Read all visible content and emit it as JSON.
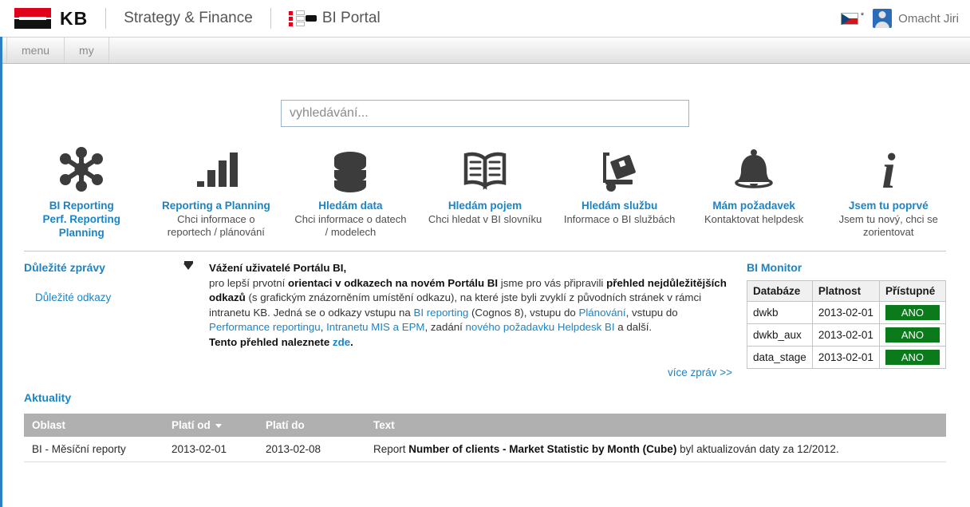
{
  "header": {
    "logo_text": "KB",
    "logo_name": "kb-logo",
    "section_title": "Strategy & Finance",
    "portal_title": "BI Portal",
    "flag_name": "czech-flag-icon",
    "user_name": "Omacht Jiri"
  },
  "menubar": {
    "tabs": [
      {
        "label": "menu"
      },
      {
        "label": "my"
      }
    ]
  },
  "search": {
    "placeholder": "vyhledávání...",
    "value": ""
  },
  "icon_nav": [
    {
      "icon": "network-nodes-icon",
      "title": "BI Reporting\nPerf. Reporting\nPlanning",
      "title_lines": [
        "BI Reporting",
        "Perf. Reporting",
        "Planning"
      ],
      "subtitle": ""
    },
    {
      "icon": "bar-chart-icon",
      "title": "Reporting a Planning",
      "title_lines": [
        "Reporting a Planning"
      ],
      "subtitle": "Chci informace o reportech / plánování",
      "sub_lines": [
        "Chci informace o",
        "reportech / plánování"
      ]
    },
    {
      "icon": "database-icon",
      "title": "Hledám data",
      "title_lines": [
        "Hledám data"
      ],
      "subtitle": "Chci informace o datech / modelech",
      "sub_lines": [
        "Chci informace o datech",
        "/ modelech"
      ]
    },
    {
      "icon": "open-book-icon",
      "title": "Hledám pojem",
      "title_lines": [
        "Hledám pojem"
      ],
      "subtitle": "Chci hledat v BI slovníku",
      "sub_lines": [
        "Chci hledat v BI slovníku"
      ]
    },
    {
      "icon": "hand-truck-icon",
      "title": "Hledám službu",
      "title_lines": [
        "Hledám službu"
      ],
      "subtitle": "Informace o BI službách",
      "sub_lines": [
        "Informace o BI službách"
      ]
    },
    {
      "icon": "bell-icon",
      "title": "Mám požadavek",
      "title_lines": [
        "Mám požadavek"
      ],
      "subtitle": "Kontaktovat helpdesk",
      "sub_lines": [
        "Kontaktovat helpdesk"
      ]
    },
    {
      "icon": "info-icon",
      "title": "Jsem tu poprvé",
      "title_lines": [
        "Jsem tu poprvé"
      ],
      "subtitle": "Jsem tu nový, chci se zorientovat",
      "sub_lines": [
        "Jsem tu nový, chci se",
        "zorientovat"
      ]
    }
  ],
  "left_panel": {
    "heading": "Důležité zprávy",
    "link_label": "Důležité odkazy",
    "collapse_icon": "collapse-icon"
  },
  "news": {
    "collapse_icon": "collapse-icon",
    "salutation": "Vážení uživatelé Portálu BI,",
    "p1_a": "pro lepší prvotní ",
    "p1_b": "orientaci v odkazech na novém Portálu BI",
    "p1_c": " jsme pro vás připravili ",
    "p1_d": "přehled nejdůležitějších odkazů",
    "p1_e": " (s grafickým znázorněním umístění odkazu), na které jste byli zvyklí z původních stránek v rámci intranetu KB. Jedná se o odkazy vstupu na ",
    "link1": "BI reporting",
    "p1_f": " (Cognos 8), vstupu do ",
    "link2": "Plánování",
    "p1_g": ", vstupu do ",
    "link3": "Performance reportingu",
    "p1_h": ", ",
    "link4": "Intranetu MIS a EPM",
    "p1_i": ", zadání ",
    "link5": "nového požadavku Helpdesk BI",
    "p1_j": " a další.",
    "closing_a": "Tento přehled naleznete ",
    "closing_link": "zde",
    "closing_b": ".",
    "more_link": "více zpráv >>"
  },
  "monitor": {
    "heading": "BI Monitor",
    "columns": [
      "Databáze",
      "Platnost",
      "Přístupné"
    ],
    "rows": [
      {
        "database": "dwkb",
        "validity": "2013-02-01",
        "accessible": "ANO"
      },
      {
        "database": "dwkb_aux",
        "validity": "2013-02-01",
        "accessible": "ANO"
      },
      {
        "database": "data_stage",
        "validity": "2013-02-01",
        "accessible": "ANO"
      }
    ],
    "badge_color": "#0a7a1a"
  },
  "aktuality": {
    "heading": "Aktuality",
    "columns": [
      "Oblast",
      "Platí od",
      "Platí do",
      "Text"
    ],
    "sorted_column": "Platí od",
    "sort_direction": "desc",
    "rows": [
      {
        "oblast": "BI - Měsíční reporty",
        "plati_od": "2013-02-01",
        "plati_do": "2013-02-08",
        "text_a": "Report ",
        "text_b": "Number of clients - Market Statistic by Month (Cube)",
        "text_c": " byl aktualizován daty za 12/2012."
      }
    ]
  },
  "colors": {
    "brand_red": "#e1001a",
    "link_blue": "#1a84c7",
    "accent_rail": "#2b7fc4",
    "icon_dark": "#3c3c3c",
    "status_green": "#0a7a1a"
  }
}
